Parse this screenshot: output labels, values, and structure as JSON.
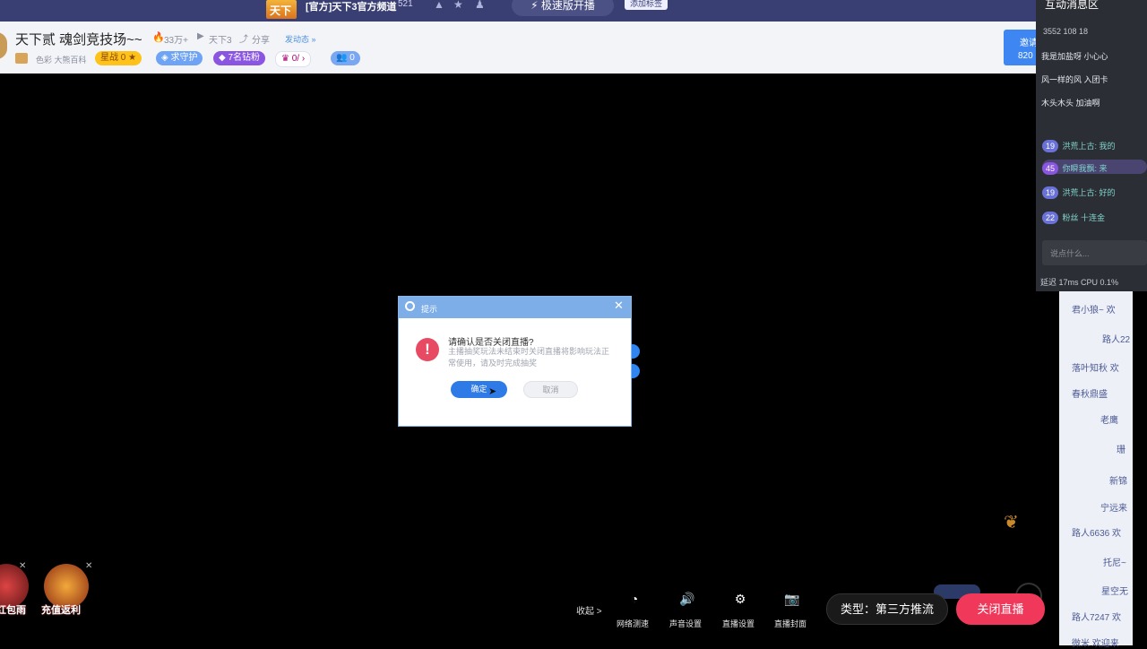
{
  "topbar": {
    "logo_text": "天下",
    "channel_title": "[官方]天下3官方频道",
    "viewer_count": "521",
    "fast_button": "极速版开播",
    "tag": "添加标签"
  },
  "room": {
    "title": "天下贰 魂剑竞技场~~",
    "heat": "33万+",
    "game": "天下3",
    "share": "分享",
    "edit_notice": "发动态 »",
    "category": "色彩 大熊百科",
    "star_label": "星战",
    "star_count": "0",
    "guard_label": "求守护",
    "fans_label": "7名钻粉",
    "noble_label": "0/",
    "rank_count": "0",
    "invite_label": "邀请",
    "invite_count": "820"
  },
  "messages": {
    "header": "互动消息区",
    "stats": "3552   108   18",
    "rows": [
      "我是加盐呀  小心心",
      "风一样的风  入团卡",
      "木头木头  加油啊"
    ],
    "badge_rows": [
      {
        "level": "19",
        "text": "洪荒上古: 我的"
      },
      {
        "level": "45",
        "text": "你瞬我飘: 来"
      },
      {
        "level": "19",
        "text": "洪荒上古: 好的"
      },
      {
        "level": "22",
        "text": "粉丝  十连金"
      }
    ],
    "input_placeholder": "说点什么...",
    "status": "延迟 17ms   CPU 0.1%"
  },
  "chat": {
    "rows": [
      "君小狼~  欢",
      "路人22",
      "落叶知秋  欢",
      "春秋鼎盛",
      "老鹰",
      "珊",
      "新锦",
      "宁远来",
      "路人6636  欢",
      "托尼~",
      "星空无",
      "路人7247  欢",
      "微米  欢迎来"
    ]
  },
  "dialog": {
    "title": "提示",
    "message": "请确认是否关闭直播?",
    "sub_message": "主播抽奖玩法未结束时关闭直播将影响玩法正常使用，请及时完成抽奖",
    "ok_label": "确定",
    "cancel_label": "取消"
  },
  "bottom": {
    "activity1_label": "红包雨",
    "activity2_label": "充值返利",
    "collapse_label": "收起 >",
    "tools": [
      {
        "label": "网络测速",
        "icon": "speedometer-icon"
      },
      {
        "label": "声音设置",
        "icon": "speaker-icon"
      },
      {
        "label": "直播设置",
        "icon": "gear-icon"
      },
      {
        "label": "直播封面",
        "icon": "camera-icon"
      }
    ],
    "type_label": "类型：第三方推流",
    "close_live_label": "关闭直播"
  },
  "colors": {
    "topbar": "#3a3f73",
    "primary_blue": "#2e7be8",
    "close_red": "#f0395a",
    "warning_red": "#e84a63"
  }
}
